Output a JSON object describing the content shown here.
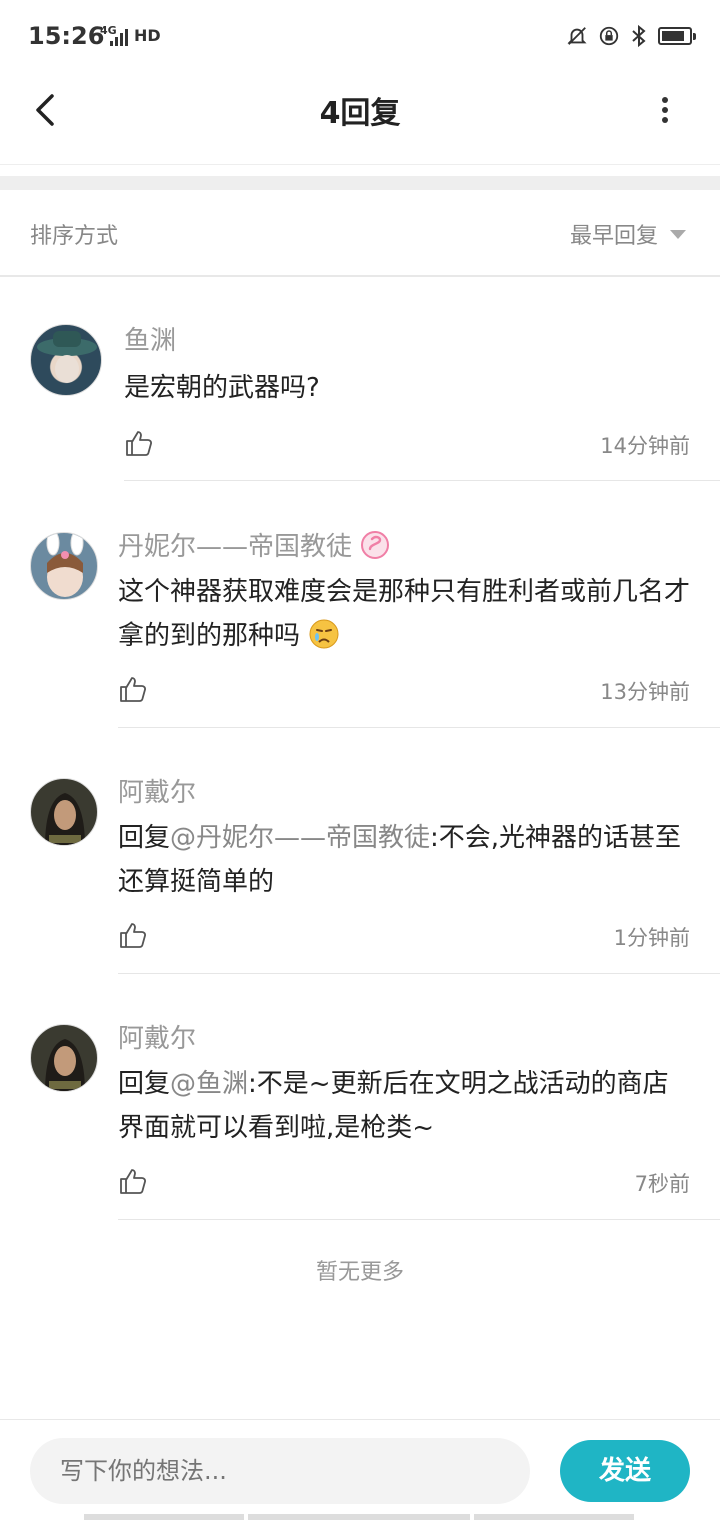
{
  "status": {
    "time": "15:26",
    "network": "4G",
    "hd": "HD"
  },
  "header": {
    "title": "4回复"
  },
  "sort": {
    "label": "排序方式",
    "value": "最早回复"
  },
  "comments": [
    {
      "name": "鱼渊",
      "text": "是宏朝的武器吗?",
      "time": "14分钟前"
    },
    {
      "name": "丹妮尔——帝国教徒",
      "text": "这个神器获取难度会是那种只有胜利者或前几名才拿的到的那种吗",
      "time": "13分钟前"
    },
    {
      "name": "阿戴尔",
      "reply_prefix": "回复",
      "mention": "@丹妮尔——帝国教徒",
      "text": ":不会,光神器的话甚至还算挺简单的",
      "time": "1分钟前"
    },
    {
      "name": "阿戴尔",
      "reply_prefix": "回复",
      "mention": "@鱼渊",
      "text": ":不是~更新后在文明之战活动的商店界面就可以看到啦,是枪类~",
      "time": "7秒前"
    }
  ],
  "footer": {
    "no_more": "暂无更多",
    "input_placeholder": "写下你的想法...",
    "send_label": "发送"
  },
  "colors": {
    "accent": "#1fb5c5",
    "muted_text": "#888888"
  }
}
